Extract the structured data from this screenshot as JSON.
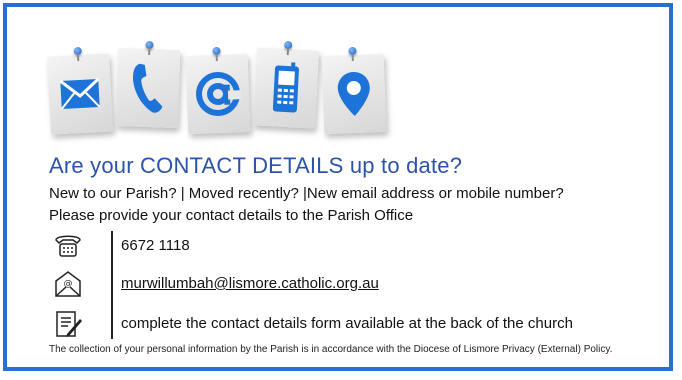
{
  "colors": {
    "frame_border": "#2a6fd0",
    "headline": "#2b54a8",
    "icon_blue": "#1e73d8",
    "link": "#2c5aa8"
  },
  "icons": [
    "envelope-icon",
    "phone-handset-icon",
    "at-sign-icon",
    "mobile-phone-icon",
    "location-pin-icon"
  ],
  "headline": "Are your CONTACT DETAILS up to date?",
  "subline": "New to our Parish? | Moved recently? |New email address or mobile number?",
  "instruction": "Please provide your contact details to the Parish Office",
  "contacts": {
    "phone": "6672 1118",
    "email": "murwillumbah@lismore.catholic.org.au",
    "form": "complete the contact details form available at the back of the church"
  },
  "privacy": "The collection of your personal information by the Parish is in accordance with the Diocese of Lismore Privacy (External) Policy."
}
